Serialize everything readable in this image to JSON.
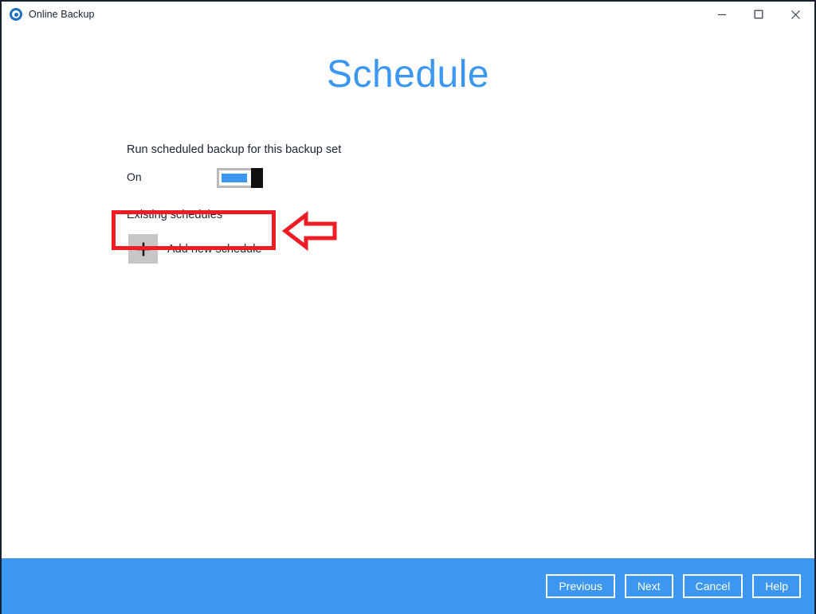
{
  "window": {
    "title": "Online Backup",
    "app_icon": "target-circle-icon",
    "controls": {
      "minimize": "minimize-icon",
      "maximize": "maximize-icon",
      "close": "close-icon"
    }
  },
  "page": {
    "title": "Schedule",
    "title_color": "#3c97f0"
  },
  "form": {
    "run_scheduled_label": "Run scheduled backup for this backup set",
    "toggle_state": "On",
    "toggle_on": true,
    "existing_schedules_label": "Existing schedules",
    "add_new_schedule_label": "Add new schedule",
    "add_icon": "plus-icon"
  },
  "annotations": {
    "highlight_color": "#ee1c25",
    "highlight_target": "add-new-schedule-row",
    "arrow_direction": "left"
  },
  "footer": {
    "background_color": "#3c97f0",
    "buttons": [
      {
        "label": "Previous",
        "name": "previous-button"
      },
      {
        "label": "Next",
        "name": "next-button"
      },
      {
        "label": "Cancel",
        "name": "cancel-button"
      },
      {
        "label": "Help",
        "name": "help-button"
      }
    ]
  }
}
